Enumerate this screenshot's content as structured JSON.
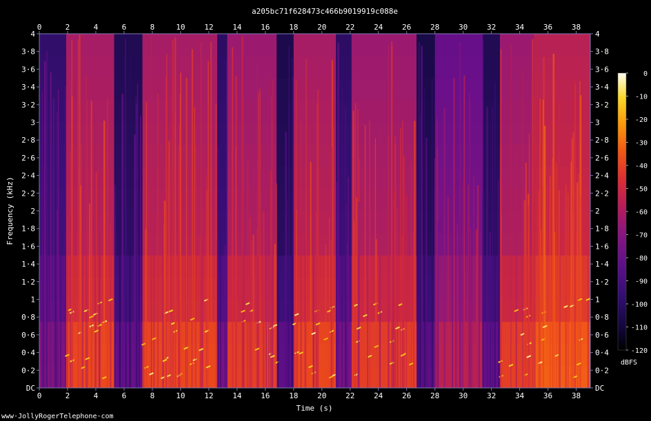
{
  "chart_data": {
    "type": "heatmap",
    "subtype": "spectrogram",
    "title": "a205bc71f628473c466b9019919c088e",
    "xlabel": "Time (s)",
    "ylabel": "Frequency (kHz)",
    "xlim": [
      0,
      39
    ],
    "ylim": [
      0,
      4
    ],
    "x_ticks": [
      "0",
      "2",
      "4",
      "6",
      "8",
      "10",
      "12",
      "14",
      "16",
      "18",
      "20",
      "22",
      "24",
      "26",
      "28",
      "30",
      "32",
      "34",
      "36",
      "38"
    ],
    "x_tick_values": [
      0,
      2,
      4,
      6,
      8,
      10,
      12,
      14,
      16,
      18,
      20,
      22,
      24,
      26,
      28,
      30,
      32,
      34,
      36,
      38
    ],
    "y_ticks": [
      "DC",
      "0·2",
      "0·4",
      "0·6",
      "0·8",
      "1",
      "1·2",
      "1·4",
      "1·6",
      "1·8",
      "2",
      "2·2",
      "2·4",
      "2·6",
      "2·8",
      "3",
      "3·2",
      "3·4",
      "3·6",
      "3·8",
      "4"
    ],
    "y_tick_values": [
      0,
      0.2,
      0.4,
      0.6,
      0.8,
      1.0,
      1.2,
      1.4,
      1.6,
      1.8,
      2.0,
      2.2,
      2.4,
      2.6,
      2.8,
      3.0,
      3.2,
      3.4,
      3.6,
      3.8,
      4.0
    ],
    "colorbar": {
      "label": "dBFS",
      "ticks": [
        "0",
        "-10",
        "-20",
        "-30",
        "-40",
        "-50",
        "-60",
        "-70",
        "-80",
        "-90",
        "-100",
        "-110",
        "-120"
      ],
      "tick_values": [
        0,
        -10,
        -20,
        -30,
        -40,
        -50,
        -60,
        -70,
        -80,
        -90,
        -100,
        -110,
        -120
      ],
      "range": [
        -120,
        0
      ],
      "colormap": [
        "#000000",
        "#1a0a4a",
        "#3b0f78",
        "#6a0f8a",
        "#9c1a6e",
        "#cc2740",
        "#ee4a1a",
        "#fb8d0a",
        "#f8d21a",
        "#fffde0"
      ]
    },
    "segments": [
      {
        "start": 0.0,
        "end": 1.9,
        "level": -88
      },
      {
        "start": 1.9,
        "end": 5.3,
        "level": -55
      },
      {
        "start": 5.3,
        "end": 7.3,
        "level": -95
      },
      {
        "start": 7.3,
        "end": 12.6,
        "level": -55
      },
      {
        "start": 12.6,
        "end": 13.3,
        "level": -90
      },
      {
        "start": 13.3,
        "end": 16.8,
        "level": -58
      },
      {
        "start": 16.8,
        "end": 18.0,
        "level": -97
      },
      {
        "start": 18.0,
        "end": 21.0,
        "level": -55
      },
      {
        "start": 21.0,
        "end": 22.1,
        "level": -90
      },
      {
        "start": 22.1,
        "end": 26.7,
        "level": -58
      },
      {
        "start": 26.7,
        "end": 28.0,
        "level": -98
      },
      {
        "start": 28.0,
        "end": 31.4,
        "level": -72
      },
      {
        "start": 31.4,
        "end": 32.6,
        "level": -95
      },
      {
        "start": 32.6,
        "end": 35.0,
        "level": -58
      },
      {
        "start": 35.0,
        "end": 39.0,
        "level": -50
      }
    ]
  },
  "footer": {
    "watermark": "www·JollyRogerTelephone·com"
  }
}
